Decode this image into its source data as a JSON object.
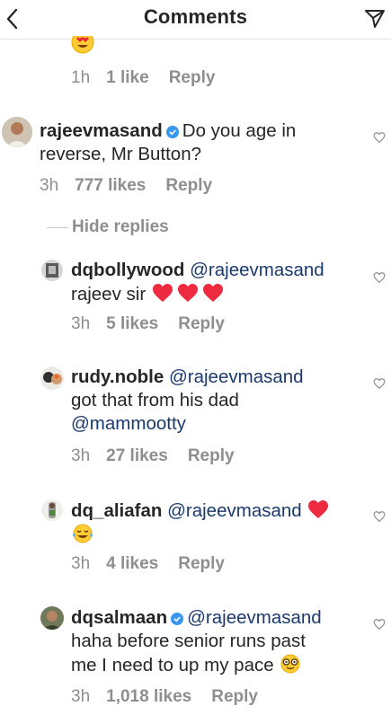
{
  "header": {
    "title": "Comments",
    "back_icon": "chevron-left-icon",
    "send_icon": "paper-plane-icon"
  },
  "top_comment": {
    "time": "1h",
    "likes": "1 like",
    "reply": "Reply"
  },
  "main_comment": {
    "username": "rajeevmasand",
    "verified": true,
    "text": "Do you age in reverse, Mr Button?",
    "time": "3h",
    "likes": "777 likes",
    "reply": "Reply"
  },
  "hide_replies_label": "Hide replies",
  "replies": [
    {
      "username": "dqbollywood",
      "mention": "@rajeevmasand",
      "text": "rajeev sir",
      "time": "3h",
      "likes": "5 likes",
      "reply": "Reply"
    },
    {
      "username": "rudy.noble",
      "mention": "@rajeevmasand",
      "text": "got that from his dad",
      "mention2": "@mammootty",
      "time": "3h",
      "likes": "27 likes",
      "reply": "Reply"
    },
    {
      "username": "dq_aliafan",
      "mention": "@rajeevmasand",
      "time": "3h",
      "likes": "4 likes",
      "reply": "Reply"
    },
    {
      "username": "dqsalmaan",
      "verified": true,
      "mention": "@rajeevmasand",
      "text_line1": "haha before senior runs past",
      "text_line2": "me I need to up my pace",
      "time": "3h",
      "likes": "1,018 likes",
      "reply": "Reply"
    }
  ],
  "colors": {
    "text": "#262626",
    "secondary": "#8e8e8e",
    "mention": "#1a3a6e",
    "verified": "#3897f0",
    "heart_red": "#ed2a3f"
  }
}
